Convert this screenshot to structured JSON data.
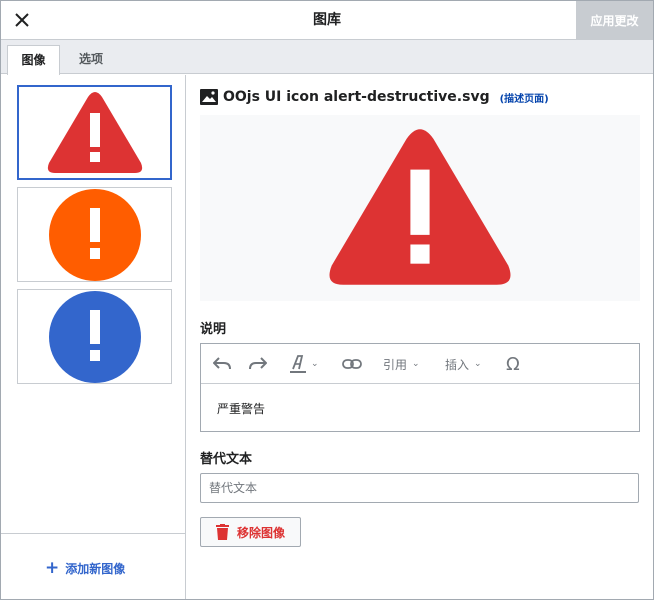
{
  "header": {
    "title": "图库",
    "apply_label": "应用更改",
    "close_icon": "close-icon"
  },
  "tabs": [
    {
      "label": "图像",
      "active": true
    },
    {
      "label": "选项",
      "active": false
    }
  ],
  "thumbnails": [
    {
      "icon": "alert-destructive-icon",
      "color": "#dd3333",
      "selected": true
    },
    {
      "icon": "alert-warning-icon",
      "color": "#ff5d00",
      "selected": false
    },
    {
      "icon": "alert-info-icon",
      "color": "#3366cc",
      "selected": false
    }
  ],
  "sidebar": {
    "add_label": "添加新图像"
  },
  "main": {
    "file_name": "OOjs UI icon alert-destructive.svg",
    "desc_link": "(描述页面)",
    "caption_label": "说明",
    "toolbar": {
      "cite_label": "引用",
      "insert_label": "插入"
    },
    "caption_value": "严重警告",
    "alt_label": "替代文本",
    "alt_placeholder": "替代文本",
    "remove_label": "移除图像"
  },
  "colors": {
    "accent": "#3366cc",
    "destructive": "#dd3333",
    "disabled": "#c8ccd1"
  }
}
